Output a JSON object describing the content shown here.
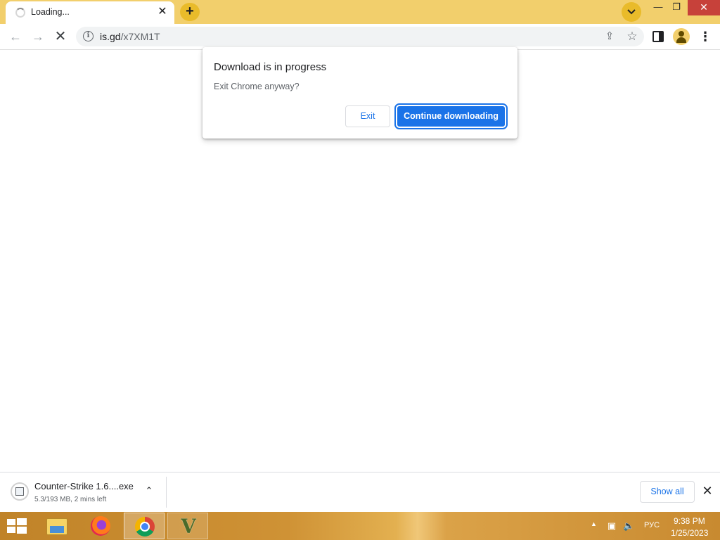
{
  "tab": {
    "title": "Loading..."
  },
  "toolbar": {
    "url_host": "is.gd",
    "url_path": "/x7XM1T"
  },
  "dialog": {
    "title": "Download is in progress",
    "message": "Exit Chrome anyway?",
    "exit_label": "Exit",
    "continue_label": "Continue downloading"
  },
  "download": {
    "file_name": "Counter-Strike 1.6....exe",
    "status": "5.3/193 MB, 2 mins left",
    "show_all_label": "Show all"
  },
  "taskbar": {
    "language": "РУС",
    "time": "9:38 PM",
    "date": "1/25/2023",
    "pinned_apps": [
      "file-explorer",
      "firefox",
      "chrome",
      "gta-v"
    ]
  },
  "colors": {
    "titlebar": "#f2cf6c",
    "accent": "#1a73e8",
    "close_button": "#c7413a"
  }
}
